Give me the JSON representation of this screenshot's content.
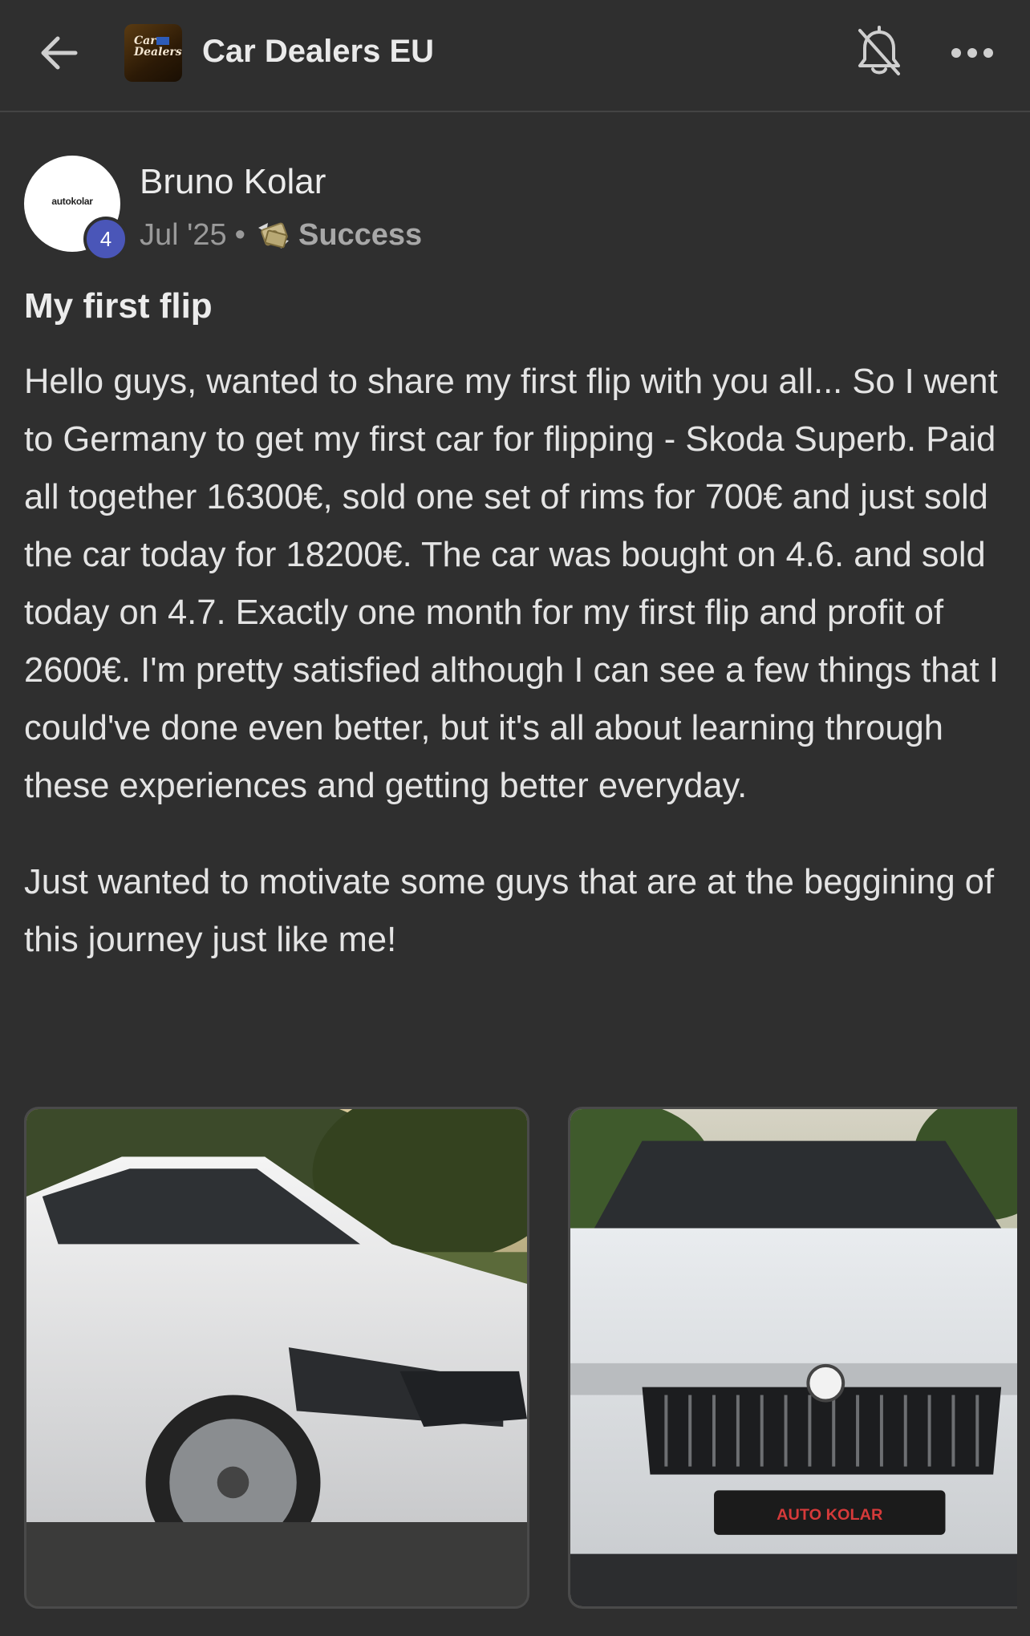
{
  "header": {
    "back_icon": "back-arrow-icon",
    "group_logo_line1": "Car",
    "group_logo_line2": "Dealers",
    "group_title": "Car Dealers EU",
    "bell_icon": "bell-off-icon",
    "more_icon": "more-horizontal-icon"
  },
  "post": {
    "author": {
      "name": "Bruno Kolar",
      "avatar_text": "autokolar",
      "level": "4"
    },
    "date": "Jul '25",
    "separator": "•",
    "category_icon": "money-wings-icon",
    "category": "Success",
    "title": "My first flip",
    "paragraphs": [
      "Hello guys, wanted to share my first flip with you all... So I went to Germany to get my first car for flipping - Skoda Superb. Paid all together 16300€, sold one set of rims for 700€ and just sold the car today for 18200€. The car was bought on 4.6. and sold today on 4.7. Exactly one month for my first flip and profit of 2600€. I'm pretty satisfied although I can see a few things that I could've done even better, but it's all about learning through these experiences and getting better everyday.",
      "Just wanted to motivate some guys that are at the beggining of this journey just like me!"
    ],
    "images": [
      {
        "alt": "white-skoda-superb-side"
      },
      {
        "alt": "white-skoda-superb-front"
      }
    ],
    "plate_text": "AUTO KOLAR"
  }
}
